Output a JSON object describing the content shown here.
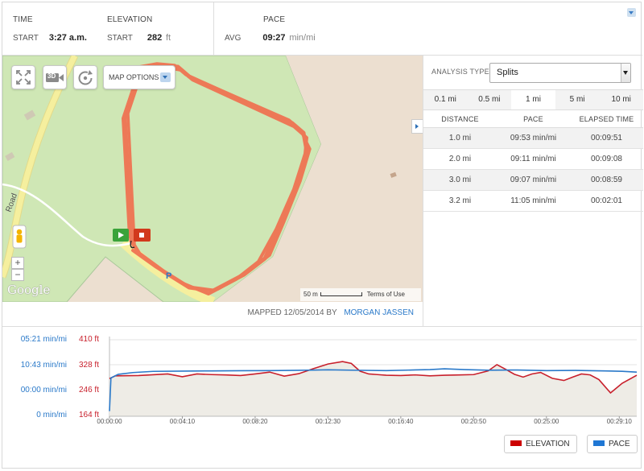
{
  "stats": {
    "time": {
      "label": "TIME",
      "row_label": "START",
      "value": "3:27 a.m."
    },
    "elevation": {
      "label": "ELEVATION",
      "row_label": "START",
      "value": "282",
      "unit": "ft"
    },
    "pace": {
      "label": "PACE",
      "row_label": "AVG",
      "value": "09:27",
      "unit": "min/mi"
    }
  },
  "map": {
    "buttons": {
      "fullscreen_icon": "fullscreen-icon",
      "view_3d_label": "3D",
      "rotate_icon": "rotate-icon"
    },
    "options_label": "MAP OPTIONS",
    "road_label": "Road",
    "zoom_in": "+",
    "zoom_out": "−",
    "scale_label": "50 m",
    "terms_label": "Terms of Use",
    "google_label": "Google",
    "marker_letter": "P",
    "colors": {
      "route": "#f07050",
      "park": "#cfe7b5",
      "land": "#ecdfd0",
      "road": "#f5ef9e"
    }
  },
  "footer": {
    "mapped_prefix": "MAPPED",
    "mapped_date": "12/05/2014",
    "by_label": "BY",
    "author": "MORGAN JASSEN"
  },
  "analysis": {
    "type_label": "ANALYSIS TYPE:",
    "type_value": "Splits",
    "tabs": [
      "0.1 mi",
      "0.5 mi",
      "1 mi",
      "5 mi",
      "10 mi"
    ],
    "active_tab": "1 mi",
    "columns": [
      "DISTANCE",
      "PACE",
      "ELAPSED TIME"
    ],
    "rows": [
      {
        "distance": "1.0 mi",
        "pace": "09:53 min/mi",
        "elapsed": "00:09:51"
      },
      {
        "distance": "2.0 mi",
        "pace": "09:11 min/mi",
        "elapsed": "00:09:08"
      },
      {
        "distance": "3.0 mi",
        "pace": "09:07 min/mi",
        "elapsed": "00:08:59"
      },
      {
        "distance": "3.2 mi",
        "pace": "11:05 min/mi",
        "elapsed": "00:02:01"
      }
    ]
  },
  "chart_data": {
    "type": "line",
    "pace_ticks": [
      "05:21 min/mi",
      "10:43 min/mi",
      "00:00 min/mi",
      "0 min/mi"
    ],
    "elevation_ticks": [
      "410 ft",
      "328 ft",
      "246 ft",
      "164 ft"
    ],
    "elevation_ylim": [
      164,
      410
    ],
    "x_ticks": [
      "00:00:00",
      "00:04:10",
      "00:08:20",
      "00:12:30",
      "00:16:40",
      "00:20:50",
      "00:25:00",
      "00:29:10"
    ],
    "x_max_seconds": 1810,
    "series": [
      {
        "name": "ELEVATION",
        "color": "#c8202c",
        "x_seconds": [
          0,
          20,
          100,
          200,
          250,
          300,
          350,
          400,
          450,
          500,
          550,
          600,
          650,
          700,
          750,
          800,
          830,
          860,
          890,
          920,
          950,
          1000,
          1050,
          1100,
          1150,
          1200,
          1250,
          1300,
          1330,
          1360,
          1390,
          1420,
          1450,
          1480,
          1520,
          1560,
          1590,
          1620,
          1650,
          1680,
          1720,
          1760,
          1810
        ],
        "values": [
          285,
          294,
          295,
          300,
          291,
          300,
          298,
          297,
          295,
          300,
          306,
          293,
          301,
          317,
          332,
          340,
          334,
          309,
          300,
          298,
          296,
          295,
          297,
          294,
          296,
          297,
          298,
          310,
          330,
          315,
          299,
          290,
          300,
          305,
          286,
          279,
          290,
          300,
          297,
          282,
          239,
          270,
          296
        ]
      },
      {
        "name": "PACE",
        "color": "#2a79c9",
        "unit": "seconds per mile",
        "x_seconds": [
          0,
          5,
          30,
          80,
          150,
          250,
          350,
          450,
          550,
          650,
          750,
          850,
          950,
          1050,
          1100,
          1150,
          1220,
          1300,
          1400,
          1500,
          1600,
          1700,
          1760,
          1810
        ],
        "values": [
          64,
          478,
          523,
          545,
          560,
          563,
          566,
          568,
          570,
          573,
          580,
          574,
          570,
          578,
          582,
          592,
          582,
          575,
          577,
          570,
          572,
          566,
          561,
          551
        ]
      }
    ]
  },
  "legend": {
    "elevation": {
      "label": "ELEVATION",
      "color": "#cc0000"
    },
    "pace": {
      "label": "PACE",
      "color": "#1f77d4"
    }
  }
}
